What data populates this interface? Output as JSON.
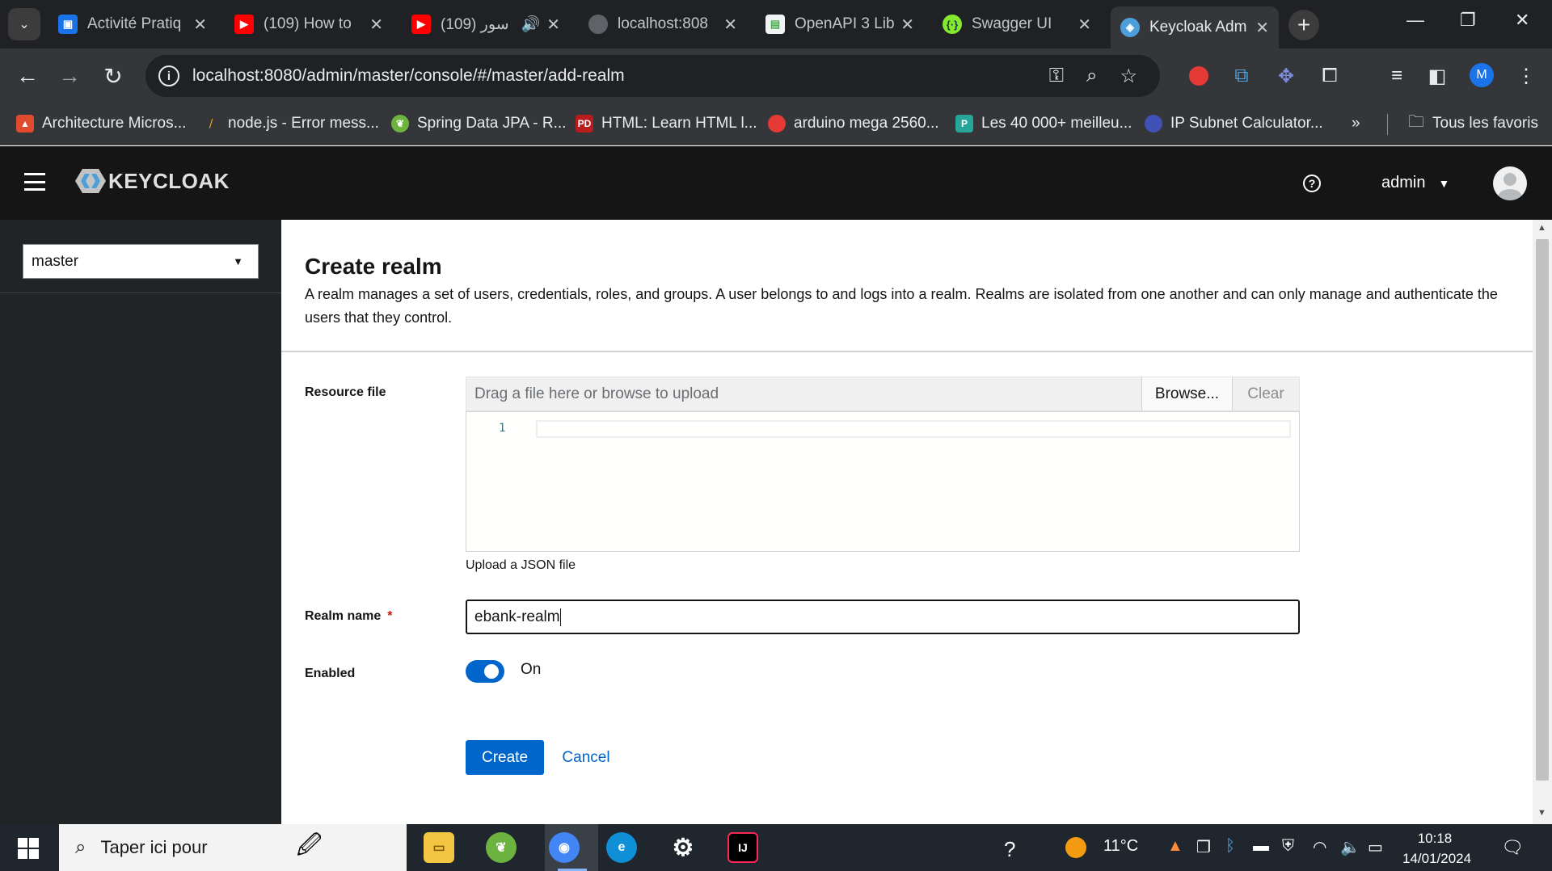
{
  "browser": {
    "tabs": [
      {
        "title": "Activité Pratiq",
        "favicon_color": "#1a73e8"
      },
      {
        "title": "(109) How to",
        "favicon_color": "#ff0000"
      },
      {
        "title": "(109) سور",
        "favicon_color": "#ff0000"
      },
      {
        "title": "localhost:808",
        "favicon_color": "#5f6368"
      },
      {
        "title": "OpenAPI 3 Lib",
        "favicon_color": "#4caf50"
      },
      {
        "title": "Swagger UI",
        "favicon_color": "#85ea2d"
      },
      {
        "title": "Keycloak Adm",
        "favicon_color": "#4d9fdb"
      }
    ],
    "url": "localhost:8080/admin/master/console/#/master/add-realm",
    "profile_initial": "M",
    "bookmarks": [
      {
        "label": "Architecture Micros...",
        "color": "#e04a2f"
      },
      {
        "label": "node.js - Error mess...",
        "color": "#f4a523"
      },
      {
        "label": "Spring Data JPA - R...",
        "color": "#6db33f"
      },
      {
        "label": "HTML: Learn HTML l...",
        "color": "#b91c1c",
        "icon_text": "PD"
      },
      {
        "label": "arduino mega 2560...",
        "color": "#e53935"
      },
      {
        "label": "Les 40 000+ meilleu...",
        "color": "#26a69a",
        "icon_text": "P"
      },
      {
        "label": "IP Subnet Calculator...",
        "color": "#3f51b5"
      }
    ],
    "bookmarks_overflow": "»",
    "all_bookmarks_label": "Tous les favoris"
  },
  "header": {
    "logo_text": "KEYCLOAK",
    "username": "admin"
  },
  "sidebar": {
    "realm_selected": "master"
  },
  "main": {
    "title": "Create realm",
    "description": "A realm manages a set of users, credentials, roles, and groups. A user belongs to and logs into a realm. Realms are isolated from one another and can only manage and authenticate the users that they control.",
    "resource_file_label": "Resource file",
    "file_placeholder": "Drag a file here or browse to upload",
    "browse_label": "Browse...",
    "clear_label": "Clear",
    "editor_line_number": "1",
    "helper_text": "Upload a JSON file",
    "realm_name_label": "Realm name",
    "required_marker": "*",
    "realm_name_value": "ebank-realm",
    "enabled_label": "Enabled",
    "enabled_state": "On",
    "enabled": true,
    "create_label": "Create",
    "cancel_label": "Cancel"
  },
  "taskbar": {
    "search_placeholder": "Taper ici pour",
    "temperature": "11°C",
    "time": "10:18",
    "date": "14/01/2024"
  },
  "colors": {
    "primary": "#0066cc",
    "header_bg": "#151515",
    "sidebar_bg": "#212427",
    "required": "#c9190b"
  }
}
